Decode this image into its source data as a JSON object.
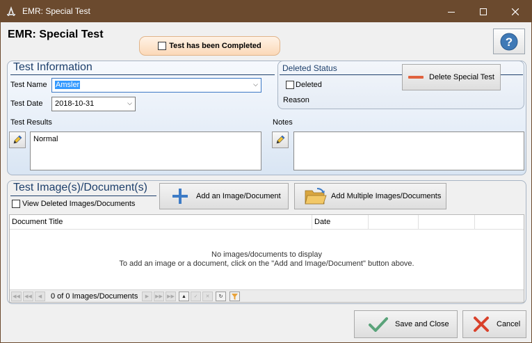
{
  "window": {
    "title": "EMR: Special Test",
    "icon": "app-logo-icon",
    "controls": [
      "minimize-icon",
      "maximize-icon",
      "close-icon"
    ]
  },
  "header": {
    "form_title": "EMR: Special Test",
    "completed_label": "Test has been Completed",
    "completed_checked": false,
    "help_icon": "help-icon"
  },
  "test_info": {
    "section_title": "Test Information",
    "test_name_label": "Test Name",
    "test_name_value": "Amsler",
    "test_date_label": "Test Date",
    "test_date_value": "2018-10-31",
    "test_results_label": "Test Results",
    "test_results_value": "Normal",
    "notes_label": "Notes",
    "notes_value": "",
    "edit_icon": "pencil-edit-icon"
  },
  "deleted_status": {
    "section_title": "Deleted Status",
    "deleted_label": "Deleted",
    "deleted_checked": false,
    "reason_label": "Reason",
    "delete_button_label": "Delete Special Test"
  },
  "images": {
    "section_title": "Test Image(s)/Document(s)",
    "view_deleted_label": "View Deleted Images/Documents",
    "add_button_label": "Add an Image/Document",
    "add_multiple_button_label": "Add Multiple Images/Documents",
    "columns": [
      "Document Title",
      "Date",
      "",
      "",
      ""
    ],
    "empty_line1": "No images/documents to display",
    "empty_line2": "To add an image or a document, click on the \"Add and Image/Document\" button above.",
    "nav_text": "0 of 0 Images/Documents"
  },
  "footer": {
    "save_label": "Save and Close",
    "cancel_label": "Cancel"
  },
  "colors": {
    "titlebar": "#6b4a2e",
    "section_title": "#1d3f6b",
    "delete_accent": "#e0623e",
    "save_check": "#5aa37a",
    "cancel_x": "#d9412b"
  }
}
